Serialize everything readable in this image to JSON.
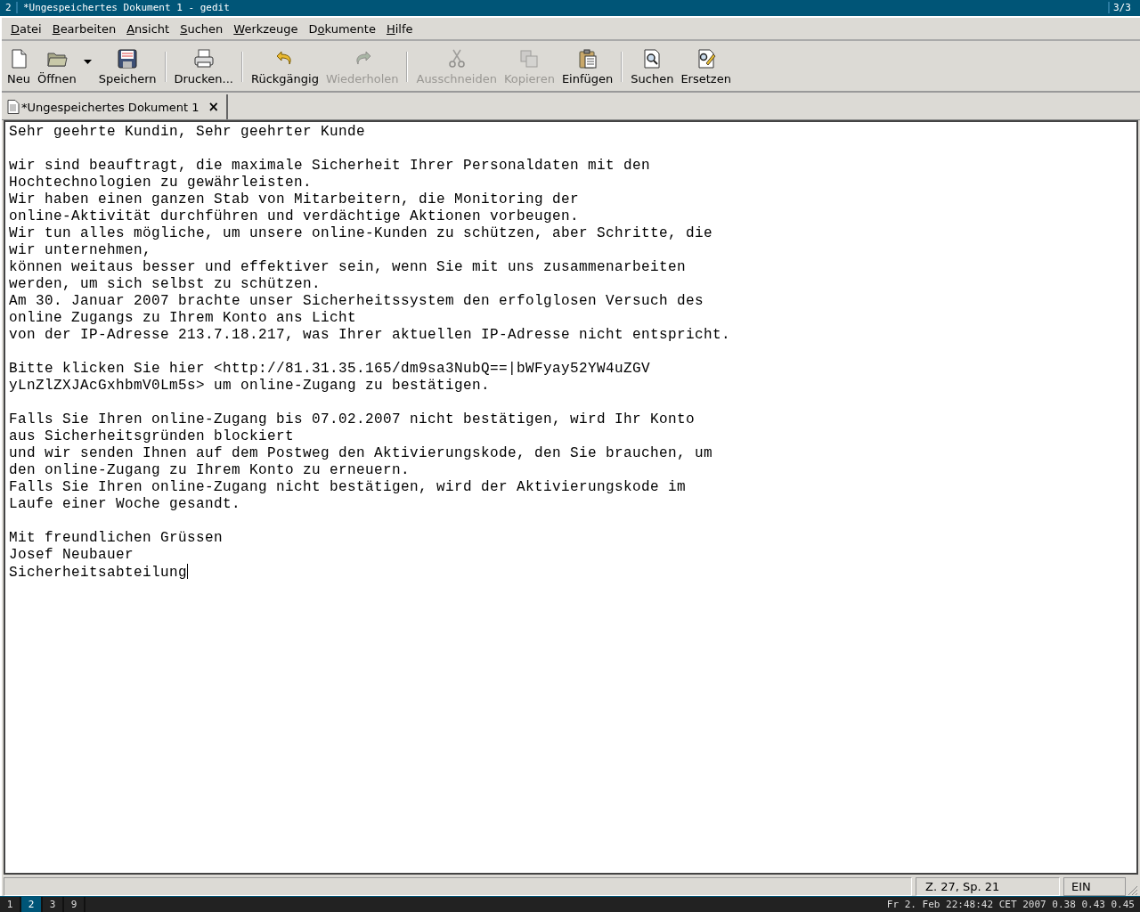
{
  "wm_bar": {
    "workspace": "2",
    "title": "*Ungespeichertes Dokument 1 - gedit",
    "window_count": "3/3"
  },
  "menu": [
    {
      "key": "D",
      "after": "atei"
    },
    {
      "key": "B",
      "after": "earbeiten"
    },
    {
      "key": "A",
      "after": "nsicht"
    },
    {
      "key": "S",
      "after": "uchen"
    },
    {
      "key": "W",
      "after": "erkzeuge"
    },
    {
      "before": "D",
      "key": "o",
      "after": "kumente"
    },
    {
      "key": "H",
      "after": "ilfe"
    }
  ],
  "toolbar": [
    {
      "kind": "button",
      "label": "Neu",
      "disabled": false
    },
    {
      "kind": "button",
      "label": "Öffnen",
      "disabled": false
    },
    {
      "kind": "dropdown"
    },
    {
      "kind": "button",
      "label": "Speichern",
      "disabled": false
    },
    {
      "kind": "separator"
    },
    {
      "kind": "button",
      "label": "Drucken...",
      "disabled": false
    },
    {
      "kind": "separator"
    },
    {
      "kind": "button",
      "label": "Rückgängig",
      "disabled": false
    },
    {
      "kind": "button",
      "label": "Wiederholen",
      "disabled": true
    },
    {
      "kind": "separator"
    },
    {
      "kind": "button",
      "label": "Ausschneiden",
      "disabled": true
    },
    {
      "kind": "button",
      "label": "Kopieren",
      "disabled": true
    },
    {
      "kind": "button",
      "label": "Einfügen",
      "disabled": false
    },
    {
      "kind": "separator"
    },
    {
      "kind": "button",
      "label": "Suchen",
      "disabled": false
    },
    {
      "kind": "button",
      "label": "Ersetzen",
      "disabled": false
    }
  ],
  "tabs": [
    {
      "label": "*Ungespeichertes Dokument 1",
      "selected": true,
      "close": "×"
    }
  ],
  "document": {
    "paragraphs": [
      [
        "Sehr geehrte Kundin, Sehr geehrter Kunde"
      ],
      [
        "wir sind beauftragt, die maximale Sicherheit Ihrer Personaldaten mit den",
        "Hochtechnologien zu gewährleisten.",
        "Wir haben einen ganzen Stab von Mitarbeitern, die Monitoring der",
        "online-Aktivität durchführen und verdächtige Aktionen vorbeugen.",
        "Wir tun alles mögliche, um unsere online-Kunden zu schützen, aber Schritte, die",
        "wir unternehmen,",
        "können weitaus besser und effektiver sein, wenn Sie mit uns zusammenarbeiten",
        "werden, um sich selbst zu schützen.",
        "Am 30. Januar 2007 brachte unser Sicherheitssystem den erfolglosen Versuch des",
        "online Zugangs zu Ihrem Konto ans Licht",
        "von der IP-Adresse 213.7.18.217, was Ihrer aktuellen IP-Adresse nicht entspricht."
      ],
      [
        "Bitte klicken Sie hier <http://81.31.35.165/dm9sa3NubQ==|bWFyay52YW4uZGV",
        "yLnZlZXJAcGxhbmV0Lm5s> um online-Zugang zu bestätigen."
      ],
      [
        "Falls Sie Ihren online-Zugang bis 07.02.2007 nicht bestätigen, wird Ihr Konto",
        "aus Sicherheitsgründen blockiert",
        "und wir senden Ihnen auf dem Postweg den Aktivierungskode, den Sie brauchen, um",
        "den online-Zugang zu Ihrem Konto zu erneuern.",
        "Falls Sie Ihren online-Zugang nicht bestätigen, wird der Aktivierungskode im",
        "Laufe einer Woche gesandt."
      ],
      [
        "Mit freundlichen Grüssen",
        "Josef Neubauer",
        "Sicherheitsabteilung"
      ]
    ]
  },
  "status_bar": {
    "position": "Z. 27, Sp. 21",
    "mode": "EIN"
  },
  "taskbar": {
    "workspaces": [
      {
        "label": "1",
        "selected": false
      },
      {
        "label": "2",
        "selected": true
      },
      {
        "label": "3",
        "selected": false
      },
      {
        "label": "9",
        "selected": false
      }
    ],
    "status": "Fr 2. Feb 22:48:42 CET 2007 0.38 0.43 0.45"
  }
}
